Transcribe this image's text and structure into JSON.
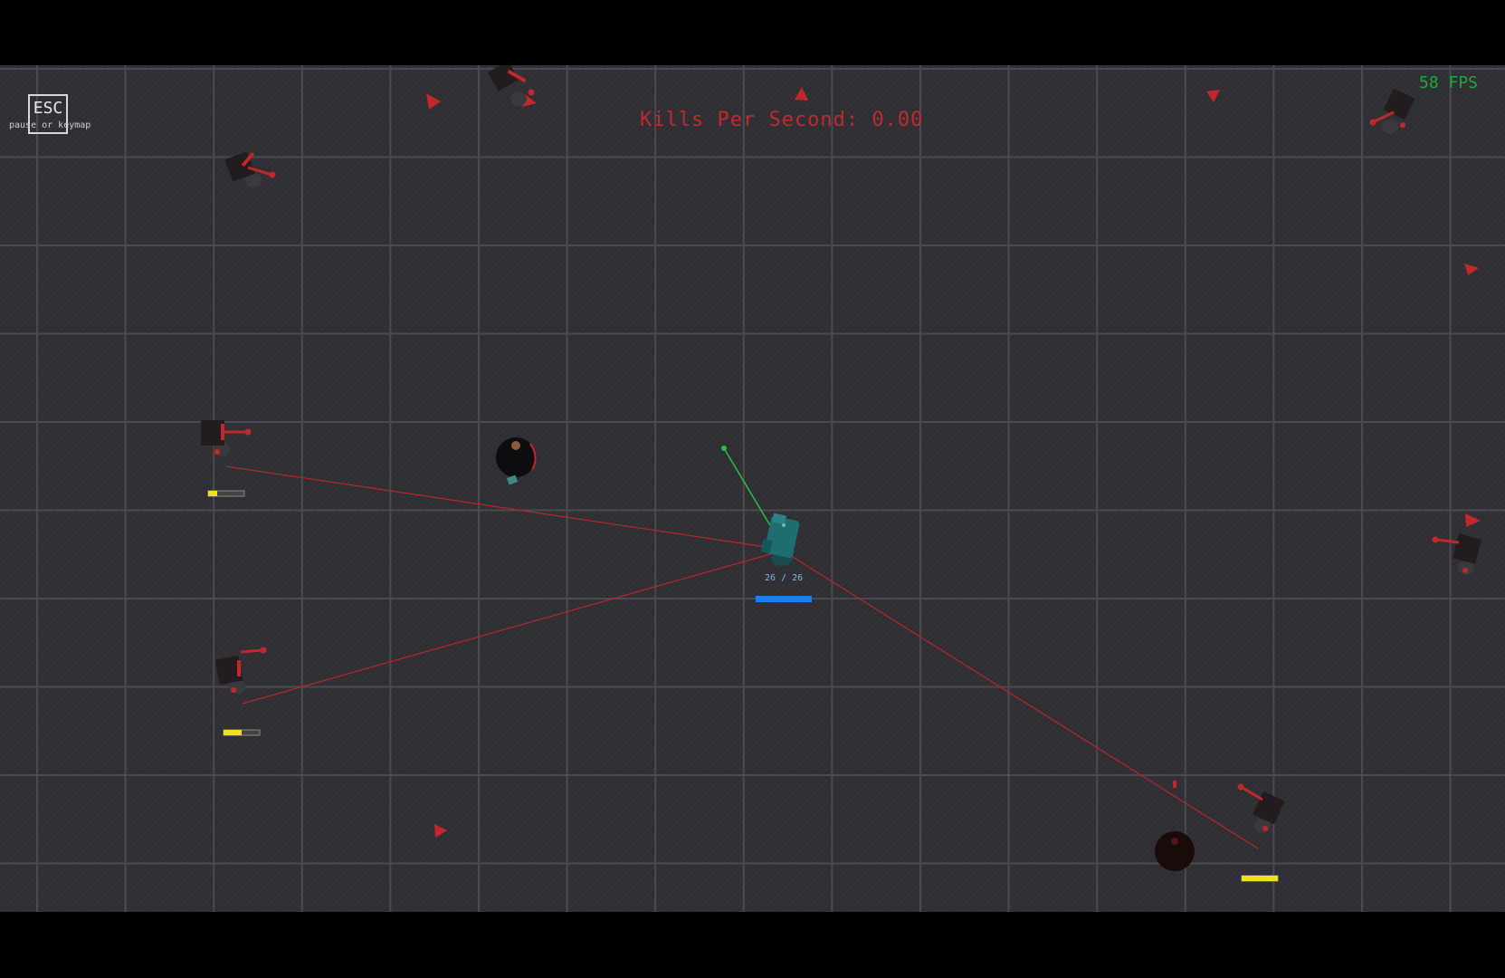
{
  "hud": {
    "esc_key_label": "ESC",
    "esc_hint": "pause or keymap",
    "kills_per_second": "Kills Per Second: 0.00",
    "fps": "58 FPS"
  },
  "player": {
    "hp_text": "26 / 26",
    "hp_fraction": 1.0
  },
  "colors": {
    "background": "#2e2e32",
    "grid_line": "#4a4a52",
    "enemy": "#c0282c",
    "player": "#1e6e70",
    "player_hp_bar": "#1e7ef0",
    "enemy_hp_bar": "#f0e020",
    "fps_text": "#1ea83a",
    "aim_line": "#28c040"
  },
  "enemies": [
    {
      "kind": "turret-bot",
      "hp_fraction": null
    },
    {
      "kind": "turret-bot",
      "hp_fraction": null
    },
    {
      "kind": "turret-bot",
      "hp_fraction": null
    },
    {
      "kind": "turret-bot",
      "hp_fraction": 0.25
    },
    {
      "kind": "turret-bot",
      "hp_fraction": 0.5
    },
    {
      "kind": "turret-bot",
      "hp_fraction": null
    },
    {
      "kind": "turret-bot",
      "hp_fraction": 1.0
    }
  ],
  "bombs": [
    {
      "kind": "black-bomb"
    },
    {
      "kind": "black-bomb"
    }
  ],
  "arrow_pickups_count": 7
}
